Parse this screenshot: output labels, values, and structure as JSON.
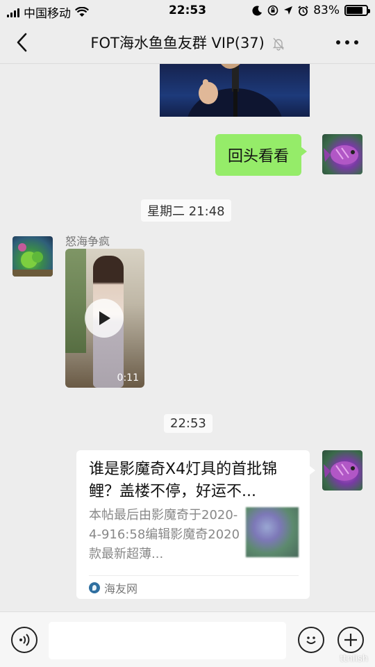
{
  "status_bar": {
    "carrier": "中国移动",
    "time": "22:53",
    "battery_percent": "83%",
    "battery_level": 0.83
  },
  "nav": {
    "title": "FOT海水鱼鱼友群 VIP(37)",
    "back_icon": "chevron-left-icon",
    "more_icon": "more-dots-icon",
    "mute_icon": "bell-muted-icon"
  },
  "messages": {
    "outgoing_text": "回头看看",
    "timestamp_1": "星期二 21:48",
    "sender_name": "怒海争疯",
    "video_duration": "0:11",
    "timestamp_2": "22:53",
    "link": {
      "title": "谁是影魔奇X4灯具的首批锦鲤？盖楼不停，好运不...",
      "description": "本帖最后由影魔奇于2020-4-916:58编辑影魔奇2020款最新超薄...",
      "source": "海友网"
    }
  },
  "input_bar": {
    "voice_icon": "voice-icon",
    "emoji_icon": "emoji-icon",
    "add_icon": "plus-circle-icon",
    "input_value": ""
  },
  "watermark": "ttnlish"
}
